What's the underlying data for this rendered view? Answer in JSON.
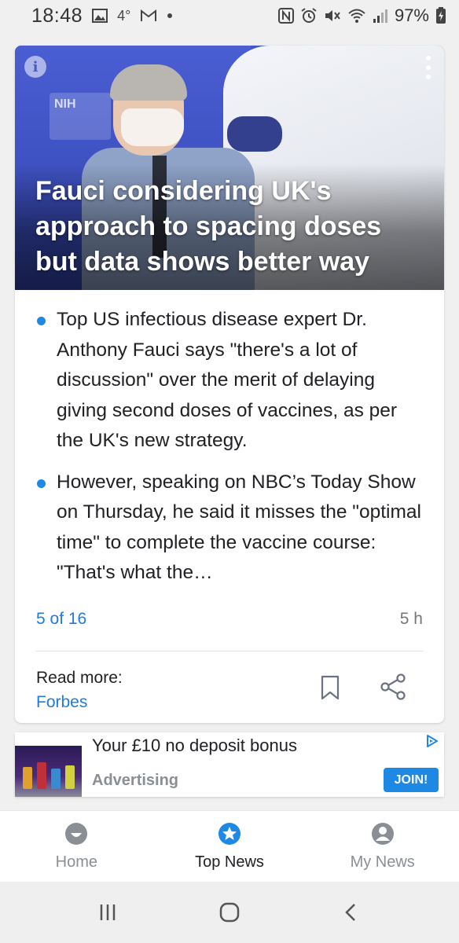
{
  "status_bar": {
    "time": "18:48",
    "temperature": "4°",
    "battery": "97%"
  },
  "article": {
    "hero_sign_text": "NIH",
    "headline": "Fauci considering UK's approach to spacing doses but data shows better way",
    "bullets": [
      "Top US infectious disease expert Dr. Anthony Fauci says \"there's a lot of discussion\" over the merit of delaying giving second doses of vaccines, as per the UK's new strategy.",
      "However, speaking on NBC’s Today Show on Thursday, he said it misses the \"optimal time\" to complete the vaccine course: \"That's what the…"
    ],
    "position": "5 of 16",
    "age": "5 h",
    "read_more_label": "Read more:",
    "source": "Forbes"
  },
  "ad": {
    "title": "Your £10 no deposit bonus",
    "label": "Advertising",
    "cta": "JOIN!"
  },
  "bottom_nav": {
    "items": [
      {
        "label": "Home",
        "icon": "smiley-icon",
        "active": false
      },
      {
        "label": "Top News",
        "icon": "star-icon",
        "active": true
      },
      {
        "label": "My News",
        "icon": "person-icon",
        "active": false
      }
    ]
  },
  "colors": {
    "accent": "#1e88e5",
    "link": "#1e7ce0",
    "inactive": "#8a8f96"
  }
}
